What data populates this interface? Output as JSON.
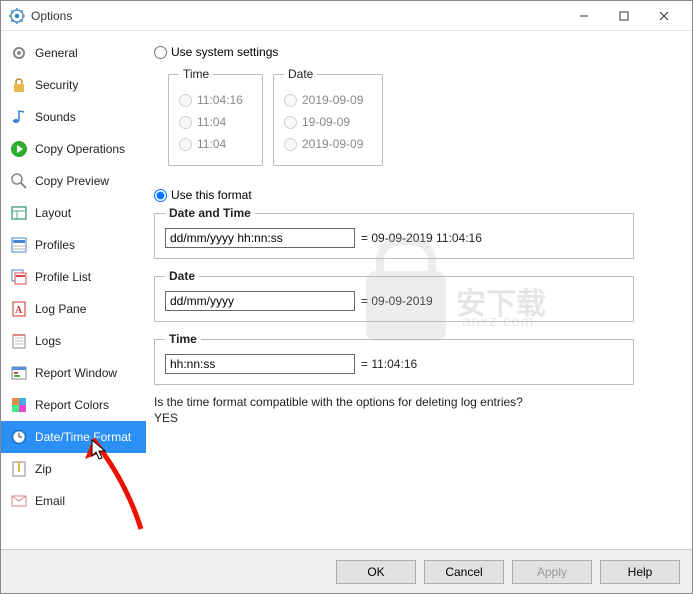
{
  "window": {
    "title": "Options",
    "buttons": {
      "ok": "OK",
      "cancel": "Cancel",
      "apply": "Apply",
      "help": "Help"
    }
  },
  "sidebar": {
    "items": [
      {
        "label": "General"
      },
      {
        "label": "Security"
      },
      {
        "label": "Sounds"
      },
      {
        "label": "Copy Operations"
      },
      {
        "label": "Copy Preview"
      },
      {
        "label": "Layout"
      },
      {
        "label": "Profiles"
      },
      {
        "label": "Profile List"
      },
      {
        "label": "Log Pane"
      },
      {
        "label": "Logs"
      },
      {
        "label": "Report Window"
      },
      {
        "label": "Report Colors"
      },
      {
        "label": "Date/Time Format"
      },
      {
        "label": "Zip"
      },
      {
        "label": "Email"
      }
    ],
    "selected_index": 12
  },
  "content": {
    "use_system_label": "Use system settings",
    "use_format_label": "Use this format",
    "time_group": {
      "legend": "Time",
      "options": [
        "11:04:16",
        "11:04",
        "11:04"
      ]
    },
    "date_group": {
      "legend": "Date",
      "options": [
        "2019-09-09",
        "19-09-09",
        "2019-09-09"
      ]
    },
    "datetime": {
      "legend": "Date and Time",
      "value": "dd/mm/yyyy hh:nn:ss",
      "example": "= 09-09-2019 11:04:16"
    },
    "date": {
      "legend": "Date",
      "value": "dd/mm/yyyy",
      "example": "= 09-09-2019"
    },
    "time": {
      "legend": "Time",
      "value": "hh:nn:ss",
      "example": "= 11:04:16"
    },
    "question": "Is the time format compatible with the options for deleting log entries?",
    "answer": "YES"
  },
  "watermark": {
    "text": "安下载",
    "sub": "anxz.com"
  }
}
